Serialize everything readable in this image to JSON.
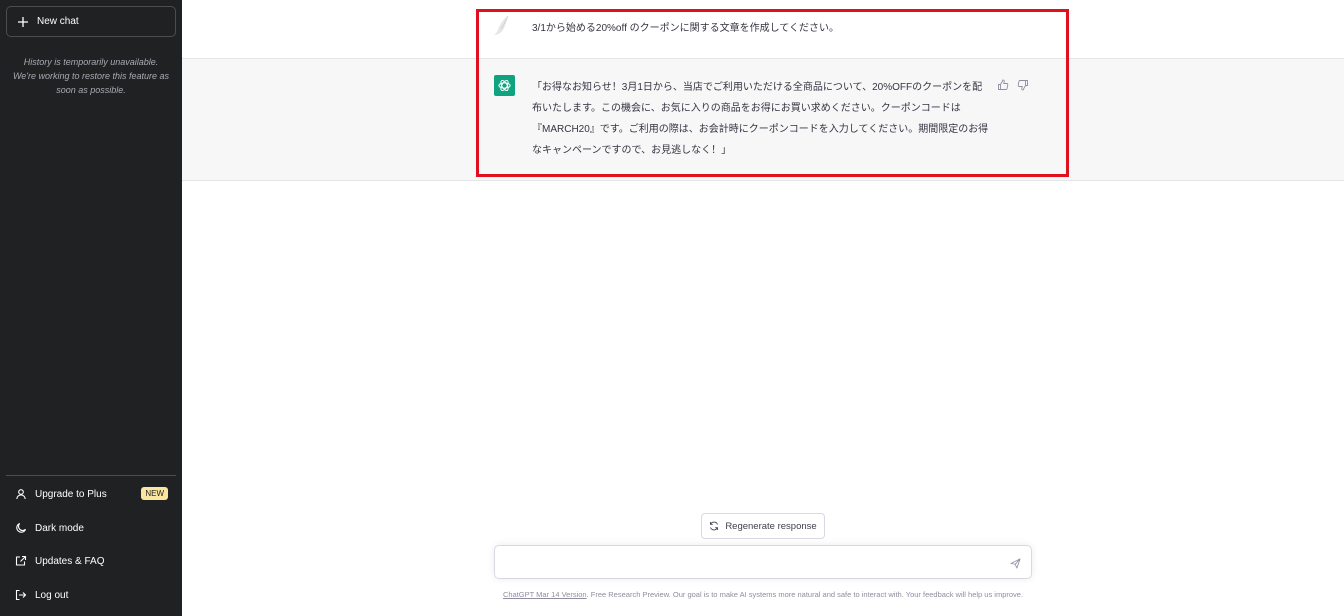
{
  "sidebar": {
    "new_chat_label": "New chat",
    "history_message": "History is temporarily unavailable. We're working to restore this feature as soon as possible.",
    "items": [
      {
        "label": "Upgrade to Plus",
        "icon": "user-icon",
        "badge": "NEW"
      },
      {
        "label": "Dark mode",
        "icon": "moon-icon"
      },
      {
        "label": "Updates & FAQ",
        "icon": "external-link-icon"
      },
      {
        "label": "Log out",
        "icon": "logout-icon"
      }
    ]
  },
  "conversation": {
    "user_message": "3/1から始める20%off のクーポンに関する文章を作成してください。",
    "assistant_message": "「お得なお知らせ！3月1日から、当店でご利用いただける全商品について、20%OFFのクーポンを配布いたします。この機会に、お気に入りの商品をお得にお買い求めください。クーポンコードは『MARCH20』です。ご利用の際は、お会計時にクーポンコードを入力してください。期間限定のお得なキャンペーンですので、お見逃しなく！」"
  },
  "composer": {
    "regenerate_label": "Regenerate response",
    "input_value": "",
    "input_placeholder": ""
  },
  "footer": {
    "version_link": "ChatGPT Mar 14 Version",
    "text": ". Free Research Preview. Our goal is to make AI systems more natural and safe to interact with. Your feedback will help us improve."
  },
  "colors": {
    "sidebar_bg": "#202123",
    "assistant_bg": "#f7f7f8",
    "brand_green": "#10a37f",
    "highlight_red": "#e0101e",
    "badge_bg": "#fae69e"
  }
}
